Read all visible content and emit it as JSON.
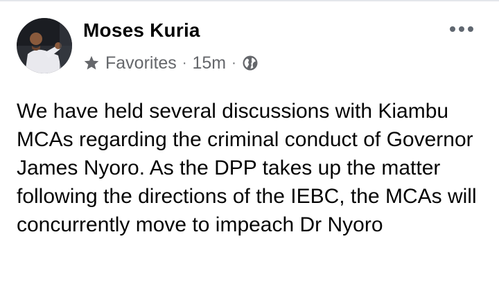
{
  "post": {
    "author": "Moses Kuria",
    "audience_label": "Favorites",
    "separator": "·",
    "timestamp": "15m",
    "privacy_icon": "globe-icon",
    "favorites_icon": "star-icon",
    "more_icon": "more-options-icon",
    "text": "We have held several discussions with Kiambu MCAs regarding the criminal conduct of Governor James Nyoro. As the DPP takes up the matter following the directions of the IEBC, the MCAs will concurrently move to impeach Dr Nyoro"
  },
  "colors": {
    "text_primary": "#050505",
    "text_secondary": "#65676b",
    "divider": "#e4e6eb"
  }
}
